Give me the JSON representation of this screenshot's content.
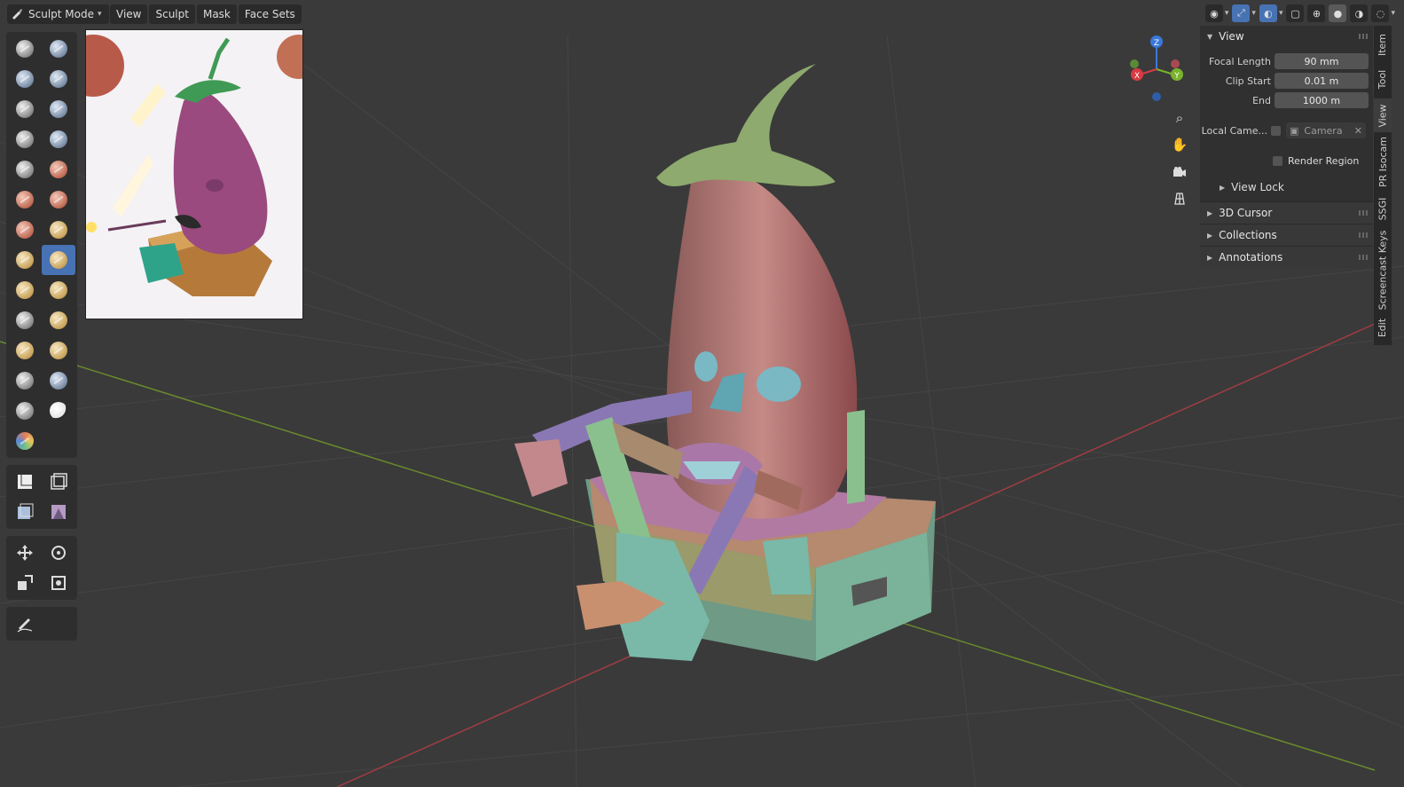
{
  "header": {
    "mode_label": "Sculpt Mode",
    "menus": [
      "View",
      "Sculpt",
      "Mask",
      "Face Sets"
    ]
  },
  "npanel": {
    "view_title": "View",
    "focal_length_label": "Focal Length",
    "focal_length_value": "90 mm",
    "clip_start_label": "Clip Start",
    "clip_start_value": "0.01 m",
    "clip_end_label": "End",
    "clip_end_value": "1000 m",
    "local_camera_label": "Local Came...",
    "camera_value": "Camera",
    "render_region_label": "Render Region",
    "view_lock_label": "View Lock",
    "subpanels": [
      "3D Cursor",
      "Collections",
      "Annotations"
    ]
  },
  "side_tabs": [
    "Item",
    "Tool",
    "View",
    "PR Isocam",
    "SSGI",
    "Screencast Keys",
    "Edit"
  ],
  "gizmo": {
    "z": "Z",
    "y": "Y",
    "x": "X"
  },
  "colors": {
    "accent": "#4772b3",
    "viewport_bg": "#393939",
    "panel_bg": "#303030"
  }
}
